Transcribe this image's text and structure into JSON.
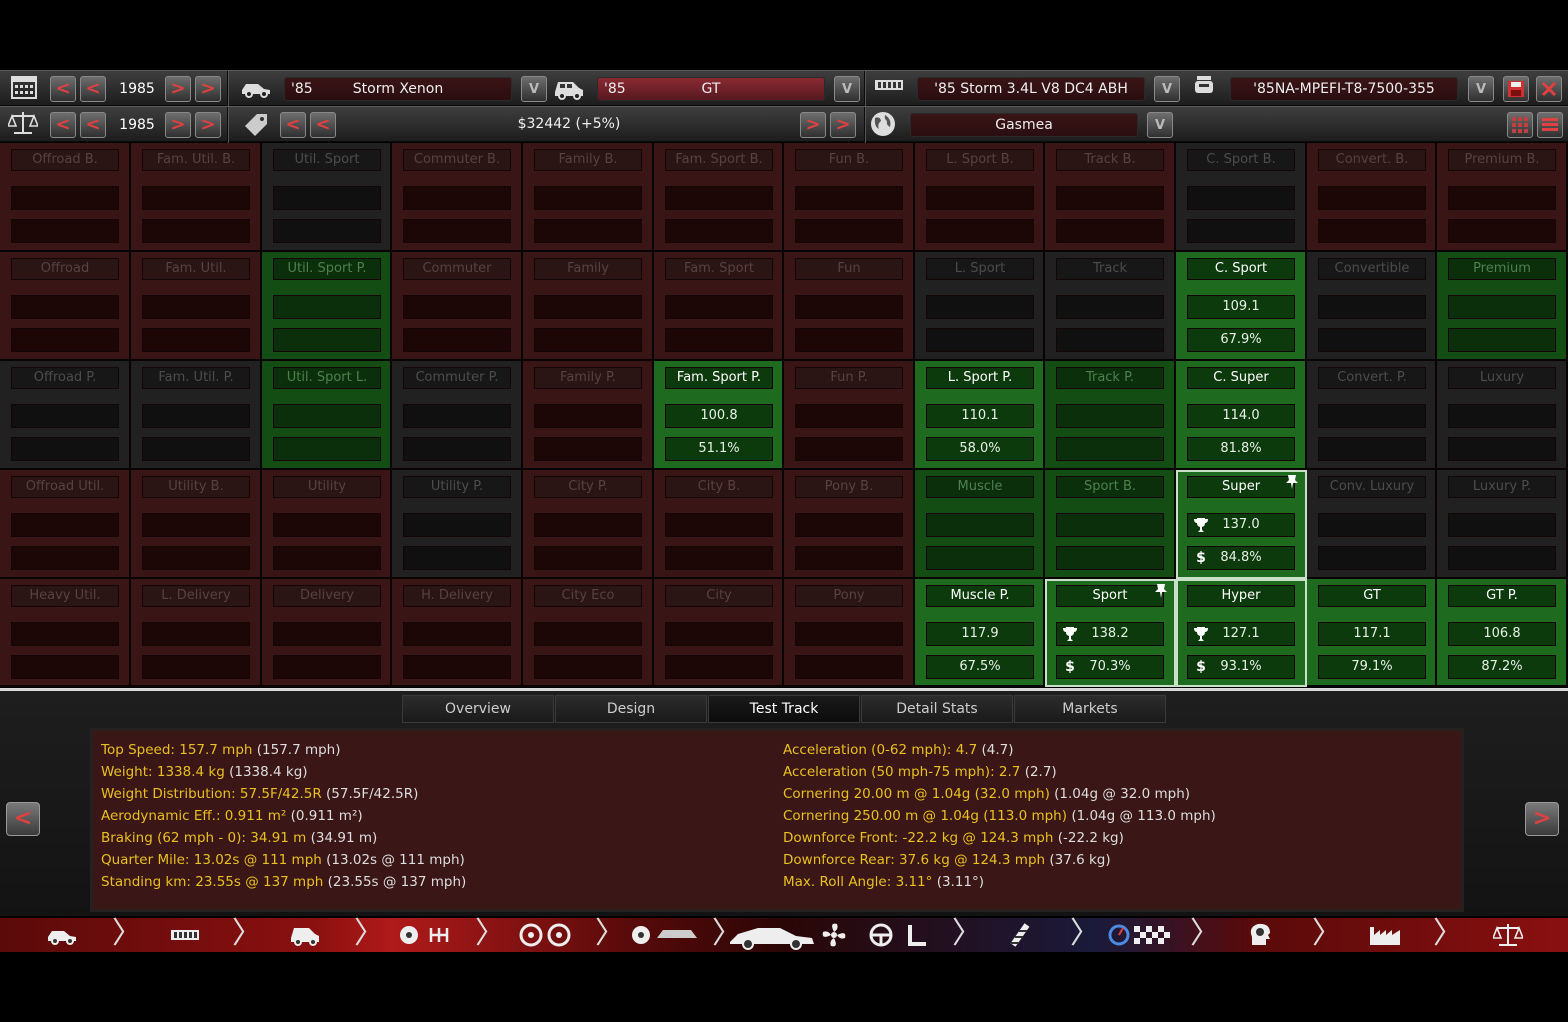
{
  "toolbar": {
    "year_top": "1985",
    "year_bottom": "1985",
    "model_prefix": "'85",
    "model_name": "Storm Xenon",
    "trim_prefix": "'85",
    "trim_name": "GT",
    "engine": "'85 Storm 3.4L V8 DC4 ABH",
    "fuel": "'85NA-MPEFI-T8-7500-355",
    "price": "$32442 (+5%)",
    "market": "Gasmea"
  },
  "grid": {
    "rows": [
      [
        {
          "label": "Offroad B."
        },
        {
          "label": "Fam. Util. B."
        },
        {
          "label": "Util. Sport"
        },
        {
          "label": "Commuter B."
        },
        {
          "label": "Family B."
        },
        {
          "label": "Fam. Sport B."
        },
        {
          "label": "Fun B."
        },
        {
          "label": "L. Sport B."
        },
        {
          "label": "Track B."
        },
        {
          "label": "C. Sport B."
        },
        {
          "label": "Convert. B."
        },
        {
          "label": "Premium B."
        }
      ],
      [
        {
          "label": "Offroad"
        },
        {
          "label": "Fam. Util."
        },
        {
          "label": "Util. Sport P."
        },
        {
          "label": "Commuter"
        },
        {
          "label": "Family"
        },
        {
          "label": "Fam. Sport"
        },
        {
          "label": "Fun"
        },
        {
          "label": "L. Sport"
        },
        {
          "label": "Track"
        },
        {
          "label": "C. Sport",
          "v1": "109.1",
          "v2": "67.9%"
        },
        {
          "label": "Convertible"
        },
        {
          "label": "Premium"
        }
      ],
      [
        {
          "label": "Offroad P."
        },
        {
          "label": "Fam. Util. P."
        },
        {
          "label": "Util. Sport L."
        },
        {
          "label": "Commuter P."
        },
        {
          "label": "Family P."
        },
        {
          "label": "Fam. Sport P.",
          "v1": "100.8",
          "v2": "51.1%"
        },
        {
          "label": "Fun P."
        },
        {
          "label": "L. Sport P.",
          "v1": "110.1",
          "v2": "58.0%"
        },
        {
          "label": "Track P."
        },
        {
          "label": "C. Super",
          "v1": "114.0",
          "v2": "81.8%"
        },
        {
          "label": "Convert. P."
        },
        {
          "label": "Luxury"
        }
      ],
      [
        {
          "label": "Offroad Util."
        },
        {
          "label": "Utility B."
        },
        {
          "label": "Utility"
        },
        {
          "label": "Utility P."
        },
        {
          "label": "City P."
        },
        {
          "label": "City B."
        },
        {
          "label": "Pony B."
        },
        {
          "label": "Muscle"
        },
        {
          "label": "Sport B."
        },
        {
          "label": "Super",
          "v1": "137.0",
          "v2": "84.8%"
        },
        {
          "label": "Conv. Luxury"
        },
        {
          "label": "Luxury P."
        }
      ],
      [
        {
          "label": "Heavy Util."
        },
        {
          "label": "L. Delivery"
        },
        {
          "label": "Delivery"
        },
        {
          "label": "H. Delivery"
        },
        {
          "label": "City Eco"
        },
        {
          "label": "City"
        },
        {
          "label": "Pony"
        },
        {
          "label": "Muscle P.",
          "v1": "117.9",
          "v2": "67.5%"
        },
        {
          "label": "Sport",
          "v1": "138.2",
          "v2": "70.3%"
        },
        {
          "label": "Hyper",
          "v1": "127.1",
          "v2": "93.1%"
        },
        {
          "label": "GT",
          "v1": "117.1",
          "v2": "79.1%"
        },
        {
          "label": "GT P.",
          "v1": "106.8",
          "v2": "87.2%"
        }
      ]
    ]
  },
  "tabs": [
    {
      "label": "Overview"
    },
    {
      "label": "Design"
    },
    {
      "label": "Test Track"
    },
    {
      "label": "Detail Stats"
    },
    {
      "label": "Markets"
    }
  ],
  "stats": {
    "left": [
      {
        "k": "Top Speed: 157.7 mph",
        "p": "(157.7 mph)"
      },
      {
        "k": "Weight: 1338.4 kg",
        "p": "(1338.4 kg)"
      },
      {
        "k": "Weight Distribution: 57.5F/42.5R",
        "p": "(57.5F/42.5R)"
      },
      {
        "k": "Aerodynamic Eff.: 0.911 m²",
        "p": "(0.911 m²)"
      },
      {
        "k": "Braking (62 mph - 0): 34.91 m",
        "p": "(34.91 m)"
      },
      {
        "k": "Quarter Mile: 13.02s @ 111 mph",
        "p": "(13.02s @ 111 mph)"
      },
      {
        "k": "Standing km: 23.55s @ 137 mph",
        "p": "(23.55s @ 137 mph)"
      }
    ],
    "right": [
      {
        "k": "Acceleration (0-62 mph): 4.7",
        "p": "(4.7)"
      },
      {
        "k": "Acceleration (50 mph-75 mph): 2.7",
        "p": "(2.7)"
      },
      {
        "k": "Cornering 20.00 m @ 1.04g (32.0 mph)",
        "p": "(1.04g @ 32.0 mph)"
      },
      {
        "k": "Cornering 250.00 m @ 1.04g (113.0 mph)",
        "p": "(1.04g @ 113.0 mph)"
      },
      {
        "k": "Downforce Front: -22.2 kg @ 124.3 mph",
        "p": "(-22.2 kg)"
      },
      {
        "k": "Downforce Rear: 37.6 kg @ 124.3 mph",
        "p": "(37.6 kg)"
      },
      {
        "k": "Max. Roll Angle: 3.11°",
        "p": "(3.11°)"
      }
    ]
  },
  "glyphs": {
    "prev": "<",
    "next": ">",
    "dropdown": "V",
    "trophy": "🏆",
    "dollar": "$",
    "pin": "📌",
    "chevron": "〉"
  },
  "colors": {
    "accent_red": "#e04040",
    "stat_yellow": "#e8c020",
    "green_active": "#1e6a1e"
  }
}
